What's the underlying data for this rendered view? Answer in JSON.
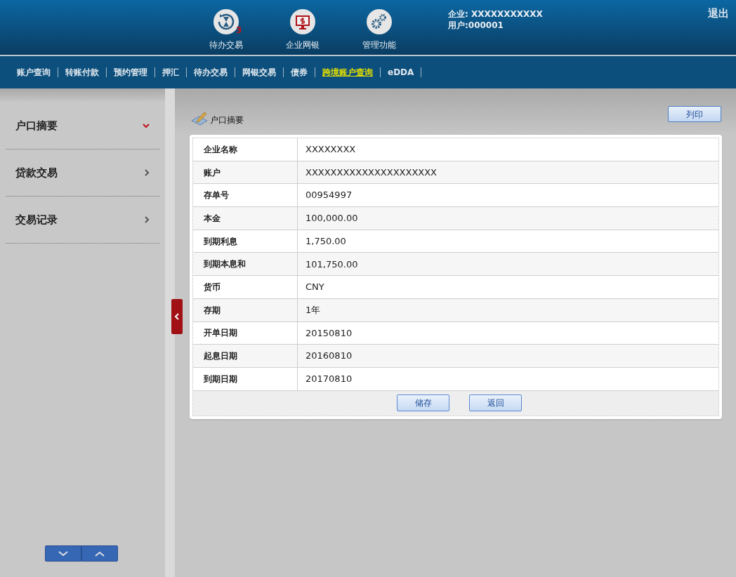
{
  "header": {
    "shortcuts": [
      {
        "kind": "pending",
        "label": "待办交易",
        "badge": "3"
      },
      {
        "kind": "netbank",
        "label": "企业网银"
      },
      {
        "kind": "admin",
        "label": "管理功能"
      }
    ],
    "company": "企业: XXXXXXXXXXX",
    "user": "用户:000001",
    "logout": "退出"
  },
  "nav": [
    {
      "label": "账户查询",
      "selected": false
    },
    {
      "label": "转账付款",
      "selected": false
    },
    {
      "label": "预约管理",
      "selected": false
    },
    {
      "label": "押汇",
      "selected": false
    },
    {
      "label": "待办交易",
      "selected": false
    },
    {
      "label": "网银交易",
      "selected": false
    },
    {
      "label": "债券",
      "selected": false
    },
    {
      "label": "跨境账户查询",
      "selected": true
    },
    {
      "label": "eDDA",
      "selected": false
    }
  ],
  "sidebar": {
    "items": [
      {
        "label": "户口摘要",
        "expanded": true
      },
      {
        "label": "贷款交易",
        "expanded": false
      },
      {
        "label": "交易记录",
        "expanded": false
      }
    ]
  },
  "content": {
    "title": "户口摘要",
    "print_button": "列印",
    "rows": [
      {
        "label": "企业名称",
        "value": "XXXXXXXX"
      },
      {
        "label": "账户",
        "value": "XXXXXXXXXXXXXXXXXXXXX"
      },
      {
        "label": "存单号",
        "value": "00954997"
      },
      {
        "label": "本金",
        "value": "100,000.00"
      },
      {
        "label": "到期利息",
        "value": "1,750.00"
      },
      {
        "label": "到期本息和",
        "value": "101,750.00"
      },
      {
        "label": "货币",
        "value": "CNY"
      },
      {
        "label": "存期",
        "value": "1年"
      },
      {
        "label": "开单日期",
        "value": "20150810"
      },
      {
        "label": "起息日期",
        "value": "20160810"
      },
      {
        "label": "到期日期",
        "value": "20170810"
      }
    ],
    "buttons": [
      "储存",
      "返回"
    ]
  }
}
